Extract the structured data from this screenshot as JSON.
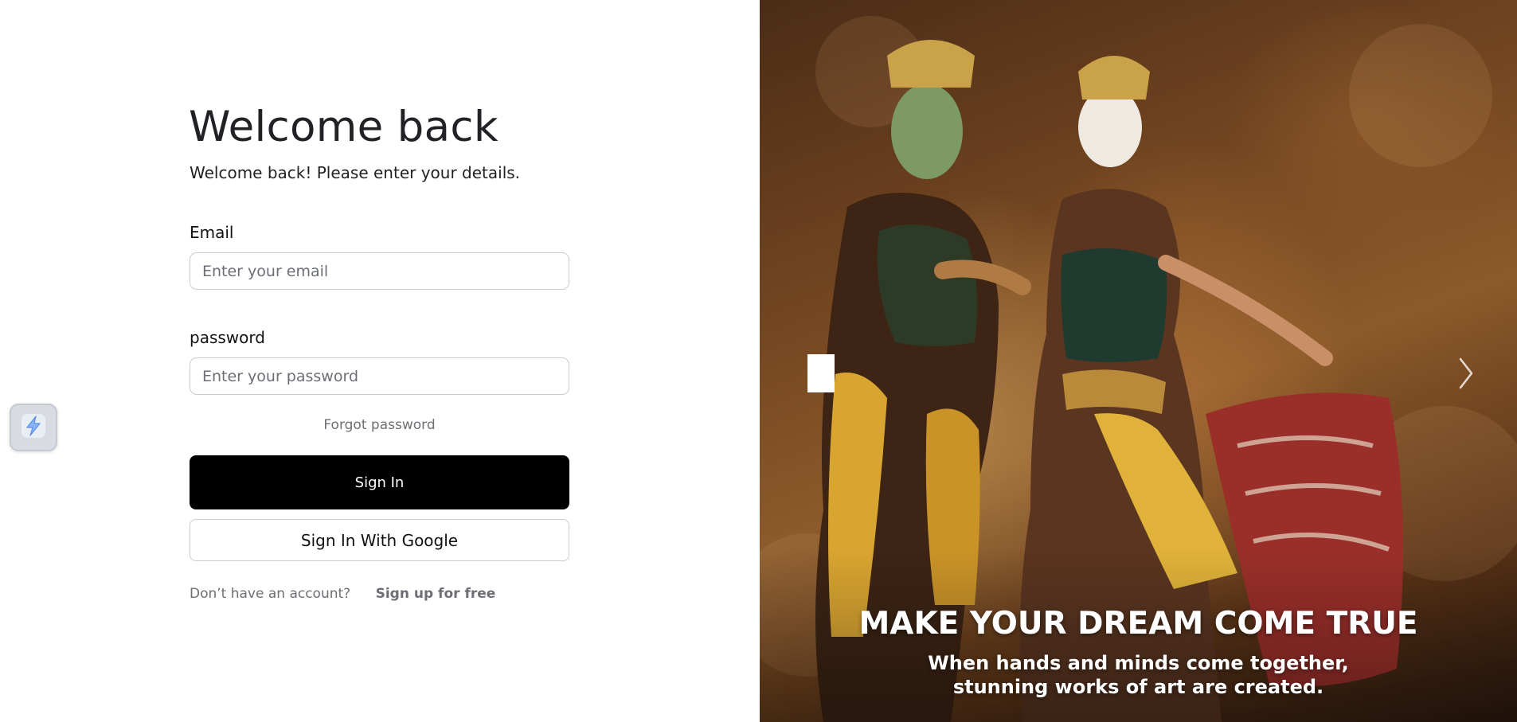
{
  "login": {
    "title": "Welcome back",
    "subtitle": "Welcome back! Please enter your details.",
    "email_label": "Email",
    "email_placeholder": "Enter your email",
    "password_label": "password",
    "password_placeholder": "Enter your password",
    "forgot_label": "Forgot password",
    "signin_label": "Sign In",
    "google_label": "Sign In With Google",
    "no_account_text": "Don’t have an account?",
    "signup_label": "Sign up for free"
  },
  "widget": {
    "icon": "lightning-bolt-icon"
  },
  "hero": {
    "title": "MAKE YOUR DREAM COME TRUE",
    "subtitle": "When hands and minds come together, stunning works of art are created.",
    "prev_icon": "chevron-left-icon",
    "next_icon": "chevron-right-icon"
  },
  "colors": {
    "primary_button": "#000000",
    "input_border": "#c9cbd1",
    "muted_text": "#6d6f74",
    "hero_brown": "#7a4a22"
  }
}
